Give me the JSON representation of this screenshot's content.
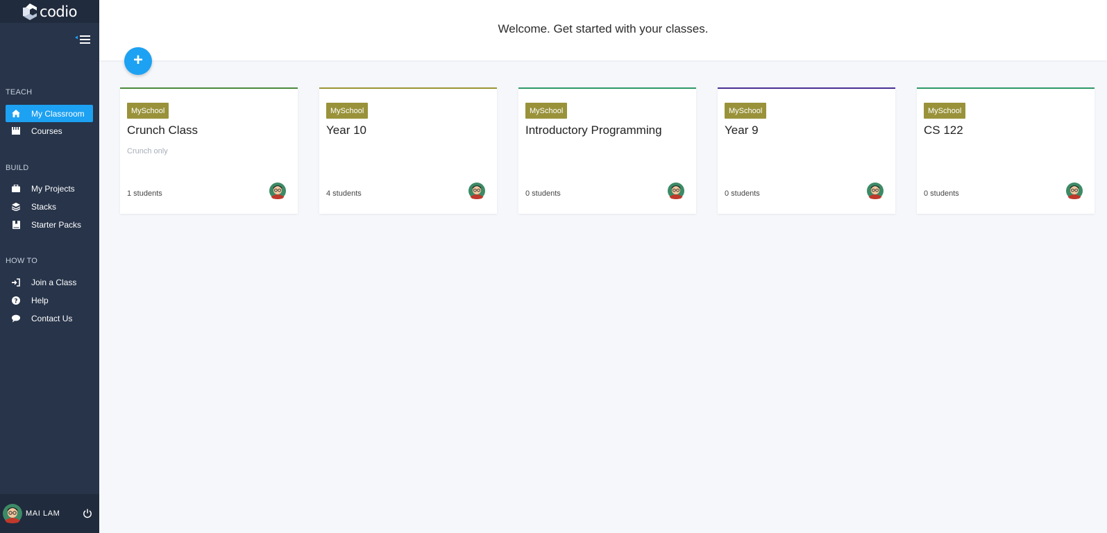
{
  "app": {
    "logo_text": "codio"
  },
  "sidebar": {
    "sections": [
      {
        "title": "TEACH",
        "items": [
          {
            "label": "My Classroom",
            "icon": "home-icon",
            "active": true
          },
          {
            "label": "Courses",
            "icon": "courses-icon"
          }
        ]
      },
      {
        "title": "BUILD",
        "items": [
          {
            "label": "My Projects",
            "icon": "briefcase-icon"
          },
          {
            "label": "Stacks",
            "icon": "stack-layers-icon"
          },
          {
            "label": "Starter Packs",
            "icon": "book-icon"
          }
        ]
      },
      {
        "title": "HOW TO",
        "items": [
          {
            "label": "Join a Class",
            "icon": "sign-in-icon"
          },
          {
            "label": "Help",
            "icon": "question-circle-icon"
          },
          {
            "label": "Contact Us",
            "icon": "chat-bubble-icon"
          }
        ]
      }
    ],
    "user": {
      "name": "MAI LAM"
    }
  },
  "header": {
    "welcome": "Welcome. Get started with your classes.",
    "add_button": "+"
  },
  "classes": [
    {
      "school": "MySchool",
      "title": "Crunch Class",
      "subtitle": "Crunch only",
      "students": "1 students",
      "accent": "#4a8a3c"
    },
    {
      "school": "MySchool",
      "title": "Year 10",
      "subtitle": "",
      "students": "4 students",
      "accent": "#9b9634"
    },
    {
      "school": "MySchool",
      "title": "Introductory Programming",
      "subtitle": "",
      "students": "0 students",
      "accent": "#2e9a67"
    },
    {
      "school": "MySchool",
      "title": "Year 9",
      "subtitle": "",
      "students": "0 students",
      "accent": "#4a2f94"
    },
    {
      "school": "MySchool",
      "title": "CS 122",
      "subtitle": "",
      "students": "0 students",
      "accent": "#2e9a67"
    }
  ],
  "colors": {
    "sidebar": "#27344a",
    "sidebar_dark": "#202b3d",
    "accent_blue": "#1da1f2",
    "badge": "#99923a",
    "background": "#f5f7fb"
  }
}
